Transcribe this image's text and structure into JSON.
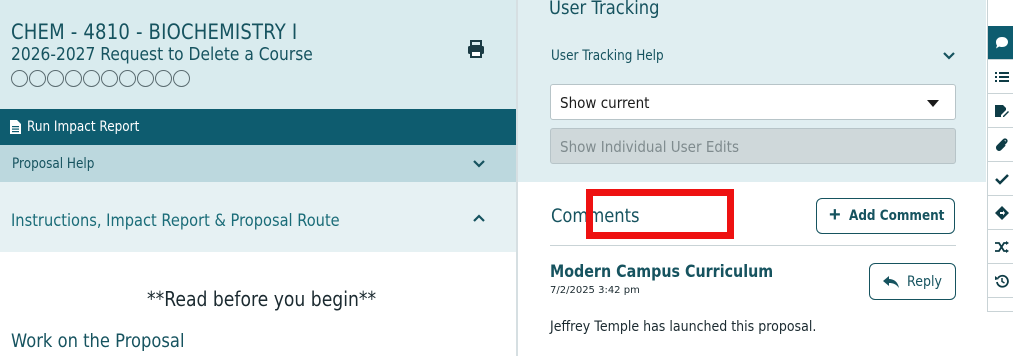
{
  "proposal": {
    "course_title": "CHEM - 4810 - BIOCHEMISTRY I",
    "subtitle": "2026-2027 Request to Delete a Course",
    "progress_circles": 10,
    "impact_report_label": "Run Impact Report",
    "proposal_help_label": "Proposal Help",
    "instructions_label": "Instructions, Impact Report & Proposal Route",
    "read_before": "**Read before you begin**",
    "work_on_proposal": "Work on the Proposal"
  },
  "user_tracking": {
    "title": "User Tracking",
    "help_label": "User Tracking Help",
    "select_value": "Show current",
    "individual_edits_label": "Show Individual User Edits"
  },
  "comments": {
    "title": "Comments",
    "add_label": "Add Comment",
    "items": [
      {
        "author": "Modern Campus Curriculum",
        "date": "7/2/2025 3:42 pm",
        "reply_label": "Reply",
        "text": "Jeffrey Temple has launched this proposal."
      }
    ]
  },
  "colors": {
    "primary": "#0e5c6f",
    "header_bg": "#d9ebee",
    "help_bg": "#bcd8de",
    "highlight": "#ee1111"
  },
  "toolbar": {
    "icons": [
      "comment-icon",
      "list-icon",
      "edit-doc-icon",
      "paperclip-icon",
      "check-icon",
      "route-icon",
      "shuffle-icon",
      "history-icon"
    ]
  }
}
